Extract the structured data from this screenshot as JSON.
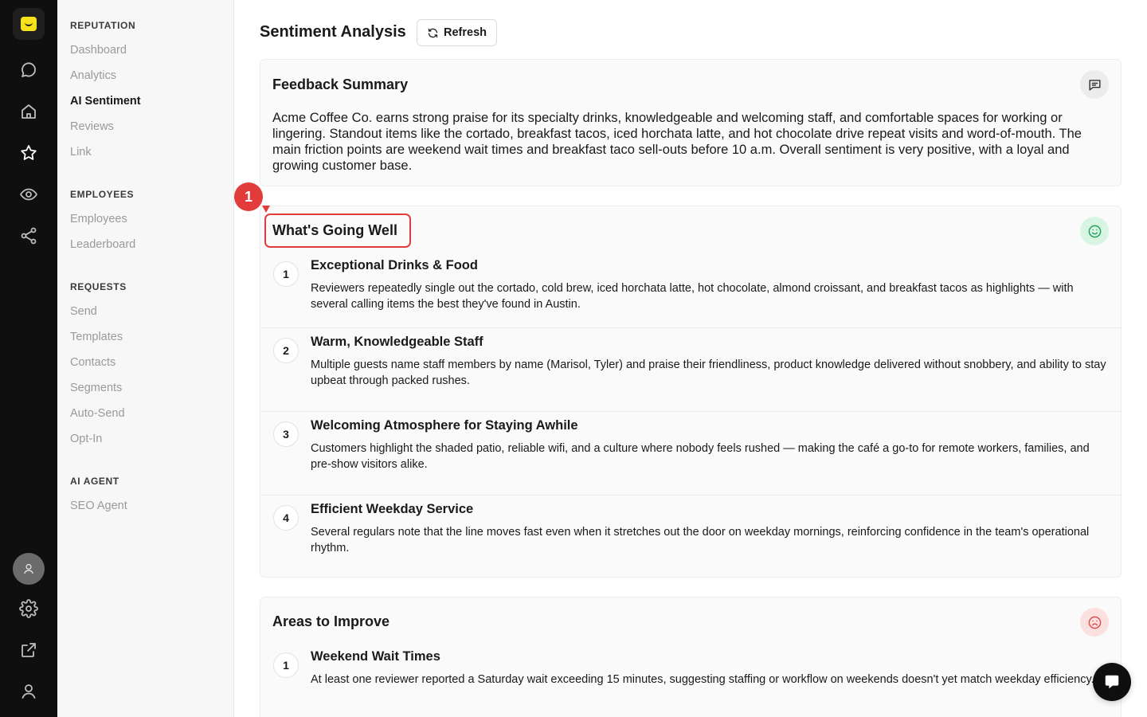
{
  "rail": {
    "items": [
      "chat-icon",
      "home-icon",
      "star-icon",
      "eye-icon",
      "share-icon"
    ],
    "bottom": [
      "avatar",
      "gear-icon",
      "external-link-icon",
      "user-icon"
    ]
  },
  "nav": {
    "sections": [
      {
        "title": "REPUTATION",
        "items": [
          "Dashboard",
          "Analytics",
          "AI Sentiment",
          "Reviews",
          "Link"
        ]
      },
      {
        "title": "EMPLOYEES",
        "items": [
          "Employees",
          "Leaderboard"
        ]
      },
      {
        "title": "REQUESTS",
        "items": [
          "Send",
          "Templates",
          "Contacts",
          "Segments",
          "Auto-Send",
          "Opt-In"
        ]
      },
      {
        "title": "AI AGENT",
        "items": [
          "SEO Agent"
        ]
      }
    ],
    "active": "AI Sentiment"
  },
  "header": {
    "title": "Sentiment Analysis",
    "refresh_label": "Refresh"
  },
  "summary": {
    "title": "Feedback Summary",
    "text": "Acme Coffee Co. earns strong praise for its specialty drinks, knowledgeable and welcoming staff, and comfortable spaces for working or lingering. Standout items like the cortado, breakfast tacos, iced horchata latte, and hot chocolate drive repeat visits and word-of-mouth. The main friction points are weekend wait times and breakfast taco sell-outs before 10 a.m. Overall sentiment is very positive, with a loyal and growing customer base."
  },
  "going_well": {
    "title": "What's Going Well",
    "items": [
      {
        "num": "1",
        "title": "Exceptional Drinks & Food",
        "desc": "Reviewers repeatedly single out the cortado, cold brew, iced horchata latte, hot chocolate, almond croissant, and breakfast tacos as highlights — with several calling items the best they've found in Austin."
      },
      {
        "num": "2",
        "title": "Warm, Knowledgeable Staff",
        "desc": "Multiple guests name staff members by name (Marisol, Tyler) and praise their friendliness, product knowledge delivered without snobbery, and ability to stay upbeat through packed rushes."
      },
      {
        "num": "3",
        "title": "Welcoming Atmosphere for Staying Awhile",
        "desc": "Customers highlight the shaded patio, reliable wifi, and a culture where nobody feels rushed — making the café a go-to for remote workers, families, and pre-show visitors alike."
      },
      {
        "num": "4",
        "title": "Efficient Weekday Service",
        "desc": "Several regulars note that the line moves fast even when it stretches out the door on weekday mornings, reinforcing confidence in the team's operational rhythm."
      }
    ]
  },
  "improve": {
    "title": "Areas to Improve",
    "items": [
      {
        "num": "1",
        "title": "Weekend Wait Times",
        "desc": "At least one reviewer reported a Saturday wait exceeding 15 minutes, suggesting staffing or workflow on weekends doesn't yet match weekday efficiency."
      }
    ]
  },
  "annotation": {
    "marker": "1"
  },
  "colors": {
    "accent": "#f7e11b",
    "positive": "#22a05a",
    "negative": "#e04a4a",
    "highlight": "#e23b3b"
  }
}
